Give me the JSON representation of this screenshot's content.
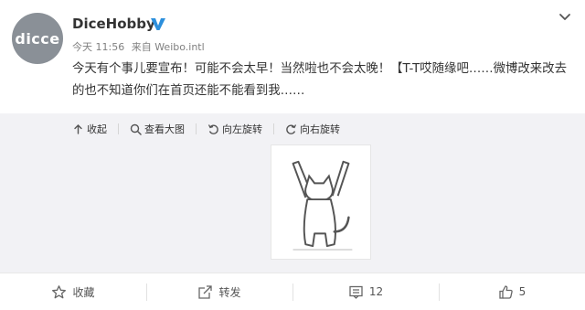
{
  "post": {
    "avatar_text": "dicce",
    "username": "DiceHobby",
    "time": "今天 11:56",
    "source": "来自 Weibo.intl",
    "text": "今天有个事儿要宣布！可能不会太早！当然啦也不会太晚！【T-T哎随缘吧……微博改来改去的也不知道你们在首页还能不能看到我……"
  },
  "media_tools": {
    "collapse": "收起",
    "view_large": "查看大图",
    "rotate_left": "向左旋转",
    "rotate_right": "向右旋转"
  },
  "actions": {
    "favorite": "收藏",
    "repost": "转发",
    "comment_count": "12",
    "like_count": "5"
  },
  "colors": {
    "verified_badge": "#2c8fdc",
    "avatar_bg": "#8a9097",
    "media_bg": "#f2f2f5"
  }
}
